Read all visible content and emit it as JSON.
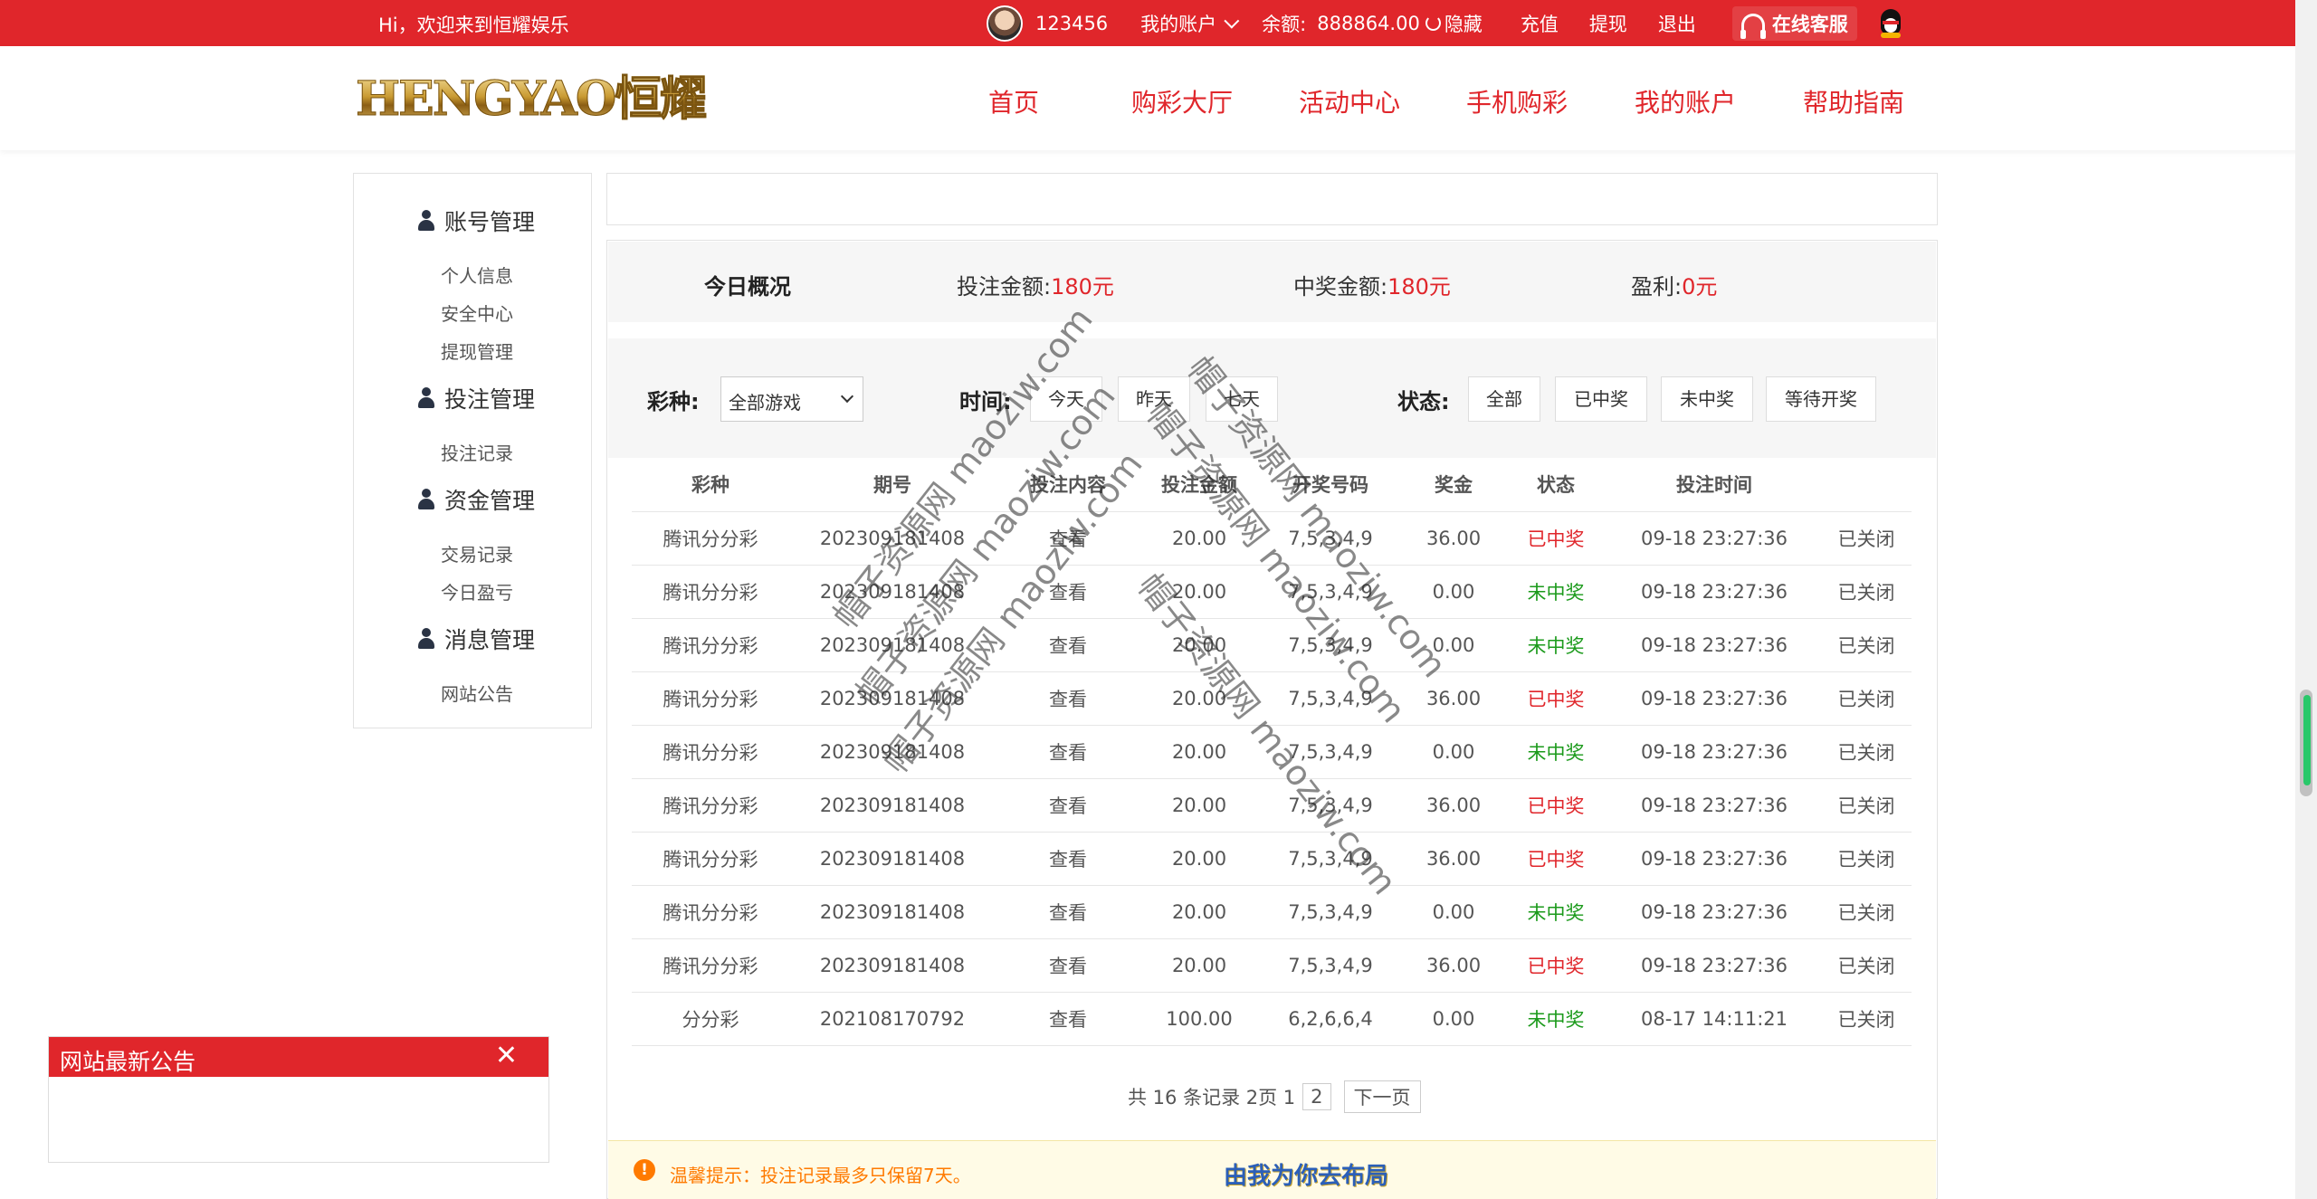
{
  "topbar": {
    "greeting": "Hi，欢迎来到恒耀娱乐",
    "username": "123456",
    "my_account": "我的账户",
    "balance_label": "余额:",
    "balance_value": "888864.00",
    "hide": "隐藏",
    "recharge": "充值",
    "withdraw": "提现",
    "logout": "退出",
    "service": "在线客服"
  },
  "header": {
    "logo_text": "HENGYAO恒耀",
    "nav": [
      "首页",
      "购彩大厅",
      "活动中心",
      "手机购彩",
      "我的账户",
      "帮助指南"
    ]
  },
  "sidebar": {
    "groups": [
      {
        "title": "账号管理",
        "items": [
          "个人信息",
          "安全中心",
          "提现管理"
        ]
      },
      {
        "title": "投注管理",
        "items": [
          "投注记录"
        ]
      },
      {
        "title": "资金管理",
        "items": [
          "交易记录",
          "今日盈亏"
        ]
      },
      {
        "title": "消息管理",
        "items": [
          "网站公告"
        ]
      }
    ]
  },
  "summary": {
    "title": "今日概况",
    "bet_label": "投注金额:",
    "bet_value": "180元",
    "win_label": "中奖金额:",
    "win_value": "180元",
    "profit_label": "盈利:",
    "profit_value": "0元"
  },
  "filter": {
    "lottery_label": "彩种:",
    "lottery_value": "全部游戏",
    "time_label": "时间:",
    "time_options": [
      "今天",
      "昨天",
      "七天"
    ],
    "status_label": "状态:",
    "status_options": [
      "全部",
      "已中奖",
      "未中奖",
      "等待开奖"
    ]
  },
  "table": {
    "headers": [
      "彩种",
      "期号",
      "投注内容",
      "投注金额",
      "开奖号码",
      "奖金",
      "状态",
      "投注时间",
      ""
    ],
    "rows": [
      [
        "腾讯分分彩",
        "202309181408",
        "查看",
        "20.00",
        "7,5,3,4,9",
        "36.00",
        "已中奖",
        "09-18 23:27:36",
        "已关闭"
      ],
      [
        "腾讯分分彩",
        "202309181408",
        "查看",
        "20.00",
        "7,5,3,4,9",
        "0.00",
        "未中奖",
        "09-18 23:27:36",
        "已关闭"
      ],
      [
        "腾讯分分彩",
        "202309181408",
        "查看",
        "20.00",
        "7,5,3,4,9",
        "0.00",
        "未中奖",
        "09-18 23:27:36",
        "已关闭"
      ],
      [
        "腾讯分分彩",
        "202309181408",
        "查看",
        "20.00",
        "7,5,3,4,9",
        "36.00",
        "已中奖",
        "09-18 23:27:36",
        "已关闭"
      ],
      [
        "腾讯分分彩",
        "202309181408",
        "查看",
        "20.00",
        "7,5,3,4,9",
        "0.00",
        "未中奖",
        "09-18 23:27:36",
        "已关闭"
      ],
      [
        "腾讯分分彩",
        "202309181408",
        "查看",
        "20.00",
        "7,5,3,4,9",
        "36.00",
        "已中奖",
        "09-18 23:27:36",
        "已关闭"
      ],
      [
        "腾讯分分彩",
        "202309181408",
        "查看",
        "20.00",
        "7,5,3,4,9",
        "36.00",
        "已中奖",
        "09-18 23:27:36",
        "已关闭"
      ],
      [
        "腾讯分分彩",
        "202309181408",
        "查看",
        "20.00",
        "7,5,3,4,9",
        "0.00",
        "未中奖",
        "09-18 23:27:36",
        "已关闭"
      ],
      [
        "腾讯分分彩",
        "202309181408",
        "查看",
        "20.00",
        "7,5,3,4,9",
        "36.00",
        "已中奖",
        "09-18 23:27:36",
        "已关闭"
      ],
      [
        "分分彩",
        "202108170792",
        "查看",
        "100.00",
        "6,2,6,6,4",
        "0.00",
        "未中奖",
        "08-17 14:11:21",
        "已关闭"
      ]
    ]
  },
  "pager": {
    "summary": "共 16 条记录 2页 1",
    "page_2": "2",
    "next": "下一页"
  },
  "tip": {
    "icon": "!",
    "text": "温馨提示：投注记录最多只保留7天。",
    "slogan": "由我为你去布局"
  },
  "notice": {
    "title": "网站最新公告",
    "close": "✕"
  },
  "watermark": {
    "text1": "帽子资源网 maoziw.com",
    "text2": "帽子资源网 maoziw.com"
  },
  "colors": {
    "brand_red": "#e0262b",
    "win": "#e0262b",
    "lose": "#1b9a1b",
    "tip": "#ff7a00"
  }
}
